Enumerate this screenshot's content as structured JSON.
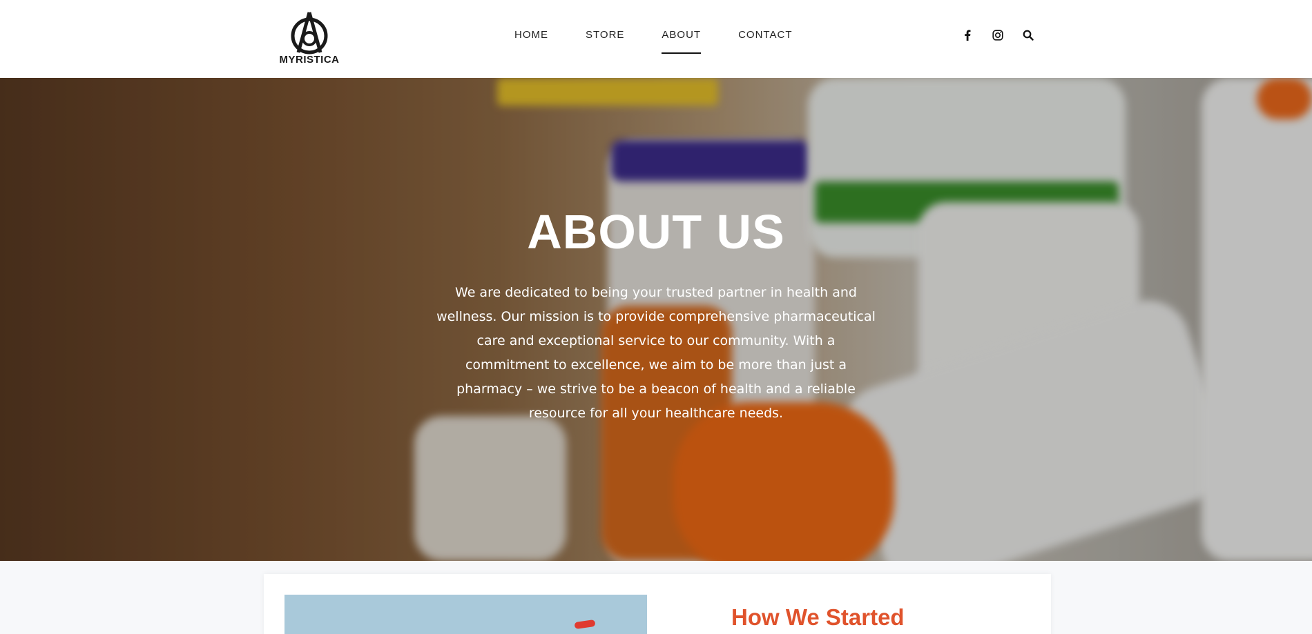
{
  "brand": {
    "logo_text": "MYRISTICA"
  },
  "nav": {
    "items": [
      {
        "label": "HOME"
      },
      {
        "label": "STORE"
      },
      {
        "label": "ABOUT"
      },
      {
        "label": "CONTACT"
      }
    ],
    "active": "ABOUT"
  },
  "social": {
    "icons": [
      "facebook-icon",
      "instagram-icon",
      "search-icon"
    ]
  },
  "hero": {
    "title": "ABOUT US",
    "text": "We are dedicated to being your trusted partner in health and wellness. Our mission is to provide comprehensive pharmaceutical care and exceptional service to our community. With a commitment to excellence, we aim to be more than just a pharmacy – we strive to be a beacon of health and a reliable resource for all your healthcare needs."
  },
  "section": {
    "title": "How We Started"
  },
  "colors": {
    "accent": "#e0532c",
    "header_bg": "#ffffff",
    "page_bg": "#f7f8fa"
  }
}
